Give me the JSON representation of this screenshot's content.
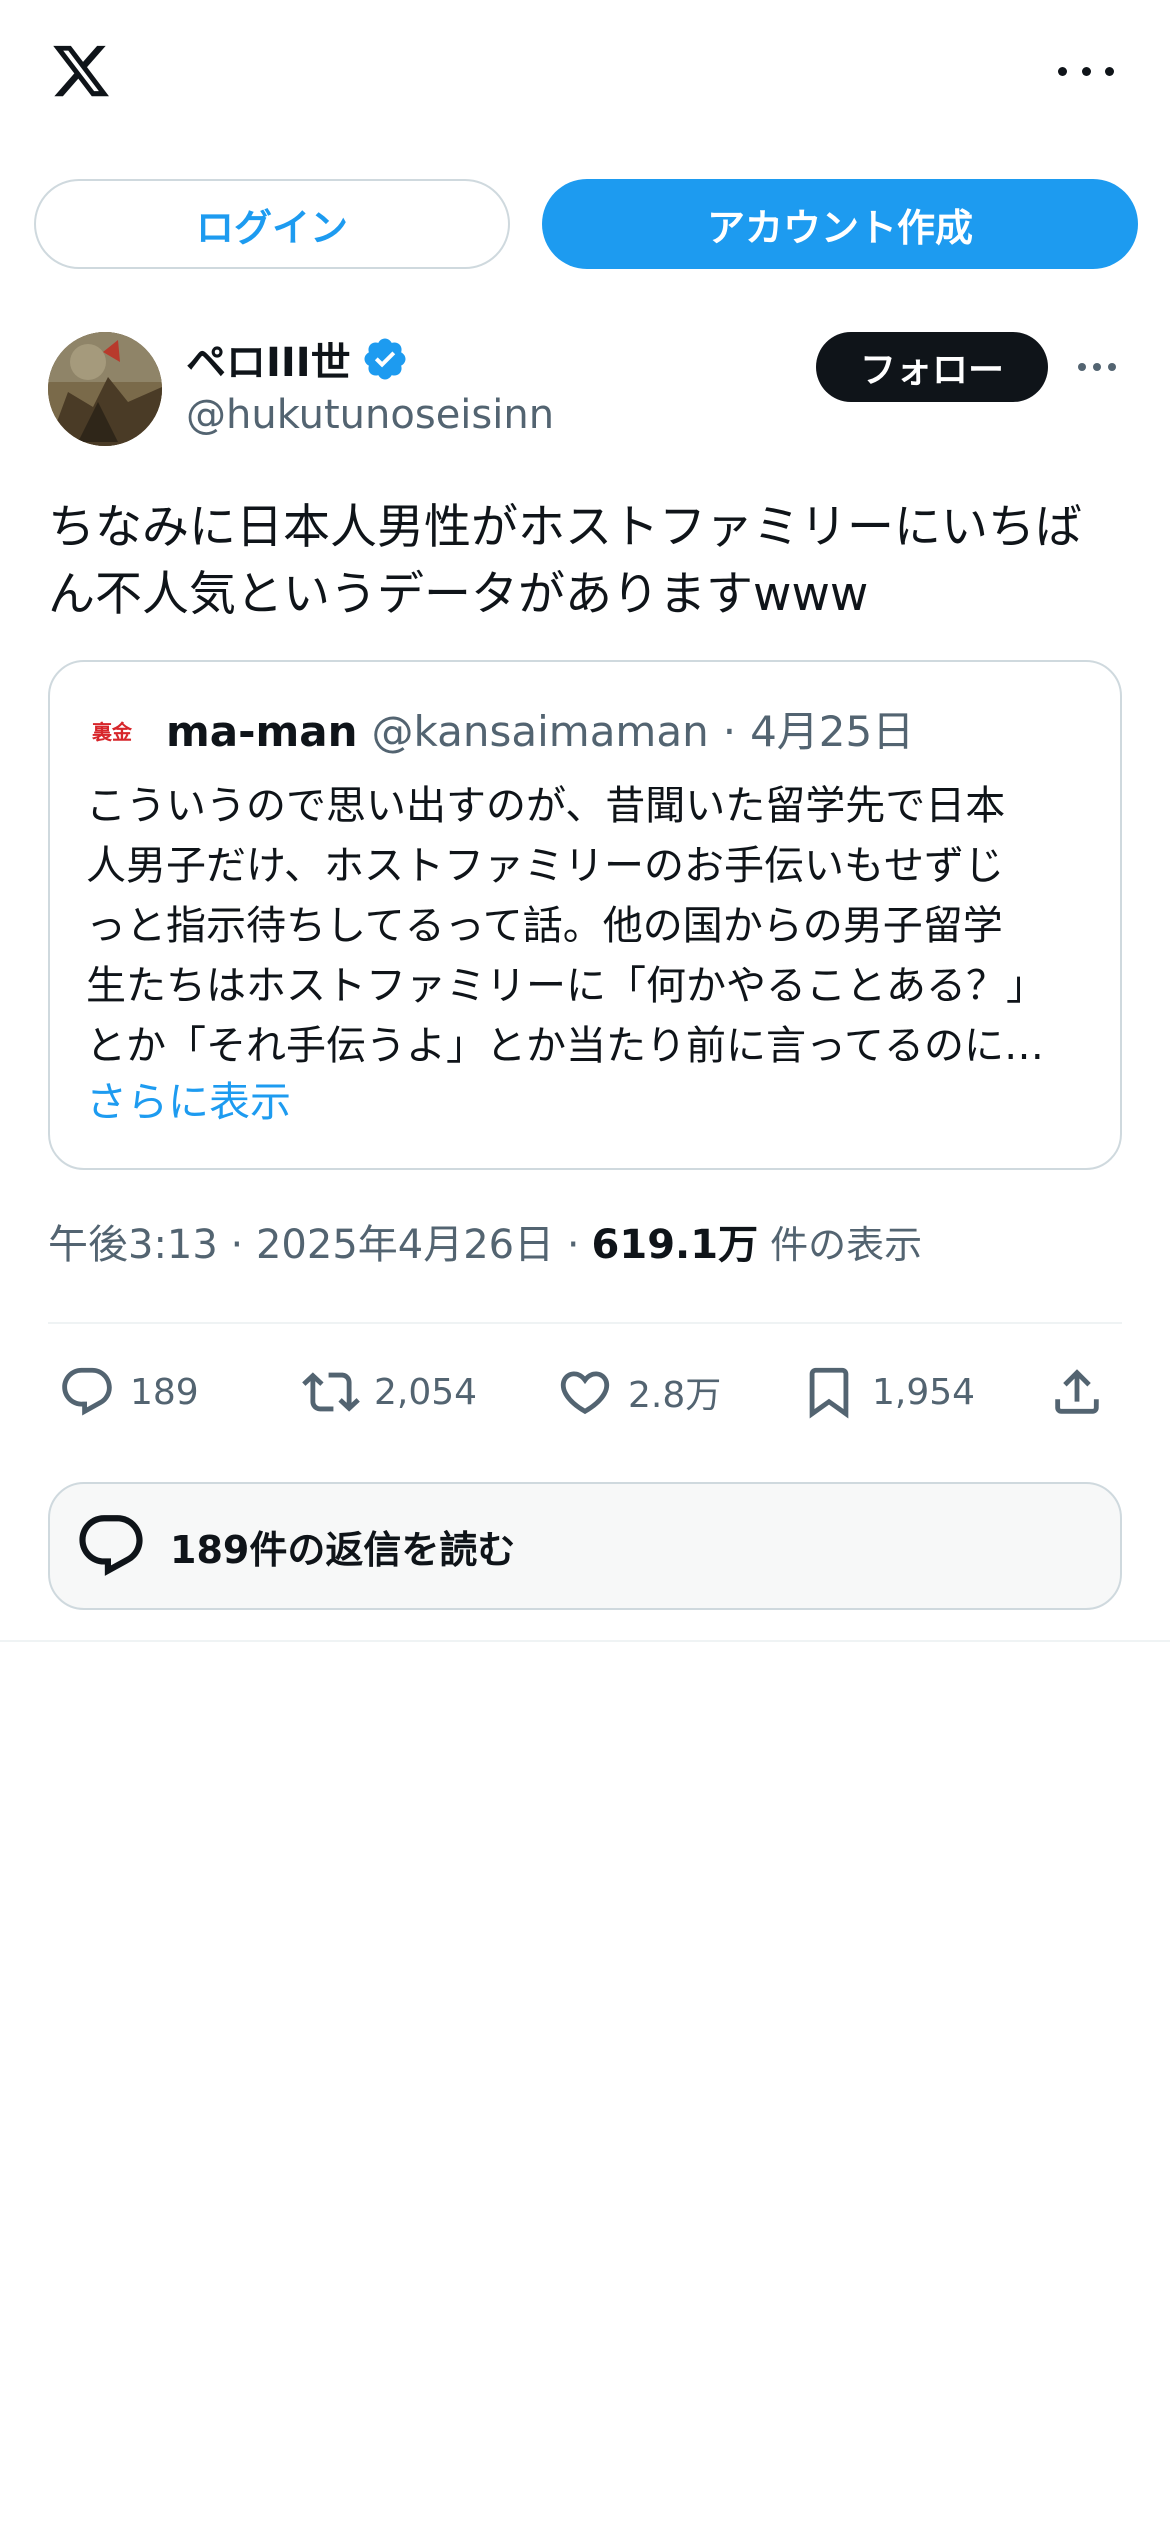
{
  "header": {
    "logo_icon": "x-logo-icon",
    "more_icon": "more-horizontal-icon"
  },
  "auth": {
    "login_label": "ログイン",
    "signup_label": "アカウント作成"
  },
  "tweet": {
    "author": {
      "display_name": "ペロIII世",
      "handle": "@hukutunoseisinn",
      "verified": true
    },
    "follow_label": "フォロー",
    "text_line1": "ちなみに日本人男性がホストファミリーにいちば",
    "text_line2": "ん不人気というデータがありますwww",
    "quote": {
      "avatar_text": "裏金",
      "display_name": "ma-man",
      "handle": "@kansaimaman",
      "separator": "·",
      "date": "4月25日",
      "lines": [
        "こういうので思い出すのが、昔聞いた留学先で日本",
        "人男子だけ、ホストファミリーのお手伝いもせずじ",
        "っと指示待ちしてるって話。他の国からの男子留学",
        "生たちはホストファミリーに「何かやることある？」",
        "とか「それ手伝うよ」とか当たり前に言ってるのに…"
      ],
      "show_more": "さらに表示"
    },
    "timestamp": "午後3:13 · 2025年4月26日 ·",
    "views_count": "619.1万",
    "views_label": "件の表示",
    "stats": {
      "replies": "189",
      "retweets": "2,054",
      "likes": "2.8万",
      "bookmarks": "1,954"
    },
    "read_replies_label": "189件の返信を読む"
  },
  "colors": {
    "accent": "#1d9bf0",
    "text": "#0f1419",
    "secondary": "#536471",
    "border": "#cfd9de"
  }
}
